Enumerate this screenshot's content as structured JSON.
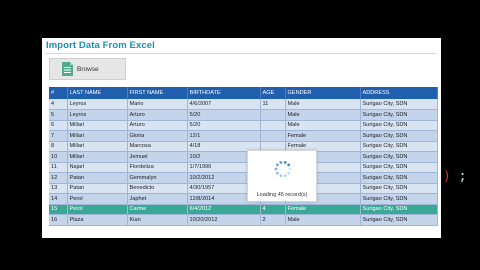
{
  "window": {
    "title": "Import Data From Excel"
  },
  "toolbar": {
    "browse_label": "Browse"
  },
  "table": {
    "columns": [
      "#",
      "LAST NAME",
      "FIRST NAME",
      "BIRTHDATE",
      "AGE",
      "GENDER",
      "ADDRESS"
    ],
    "rows": [
      [
        "4",
        "Leyros",
        "Mario",
        "4/6/2007",
        "11",
        "Male",
        "Surigao City, SDN"
      ],
      [
        "5",
        "Leyros",
        "Arturo",
        "5/20",
        "",
        "Male",
        "Surigao City, SDN"
      ],
      [
        "6",
        "Millari",
        "Arturo",
        "5/20",
        "",
        "Male",
        "Surigao City, SDN"
      ],
      [
        "7",
        "Millari",
        "Gloria",
        "12/1",
        "",
        "Female",
        "Surigao City, SDN"
      ],
      [
        "8",
        "Millari",
        "Marcosa",
        "4/18",
        "",
        "Female",
        "Surigao City, SDN"
      ],
      [
        "10",
        "Millari",
        "Jemuel",
        "10/2",
        "",
        "Male",
        "Surigao City, SDN"
      ],
      [
        "11",
        "Najarl",
        "Flordeliza",
        "1/7/1990",
        "20",
        "Female",
        "Surigao City, SDN"
      ],
      [
        "12",
        "Patan",
        "Gemmalyn",
        "10/2/2012",
        "4",
        "Female",
        "Surigao City, SDN"
      ],
      [
        "13",
        "Patan",
        "Benedicto",
        "4/30/1957",
        "58",
        "Male",
        "Surigao City, SDN"
      ],
      [
        "14",
        "Perol",
        "Japhet",
        "12/8/2014",
        "9 mon",
        "Male",
        "Surigao City, SDN"
      ],
      [
        "15",
        "Perol",
        "Carme",
        "6/4/2012",
        "4",
        "Female",
        "Surigao City, SDN"
      ],
      [
        "16",
        "Plaza",
        "Kian",
        "10/20/2012",
        "2",
        "Male",
        "Surigao City, SDN"
      ]
    ],
    "selected_row": 10
  },
  "loading": {
    "text": "Loading 45 record(s)"
  },
  "background_code": {
    "paren": ")",
    "semicolon": ";"
  },
  "colors": {
    "header": "#1f5fae",
    "selected": "#3aa896",
    "title": "#1a8fb0"
  }
}
